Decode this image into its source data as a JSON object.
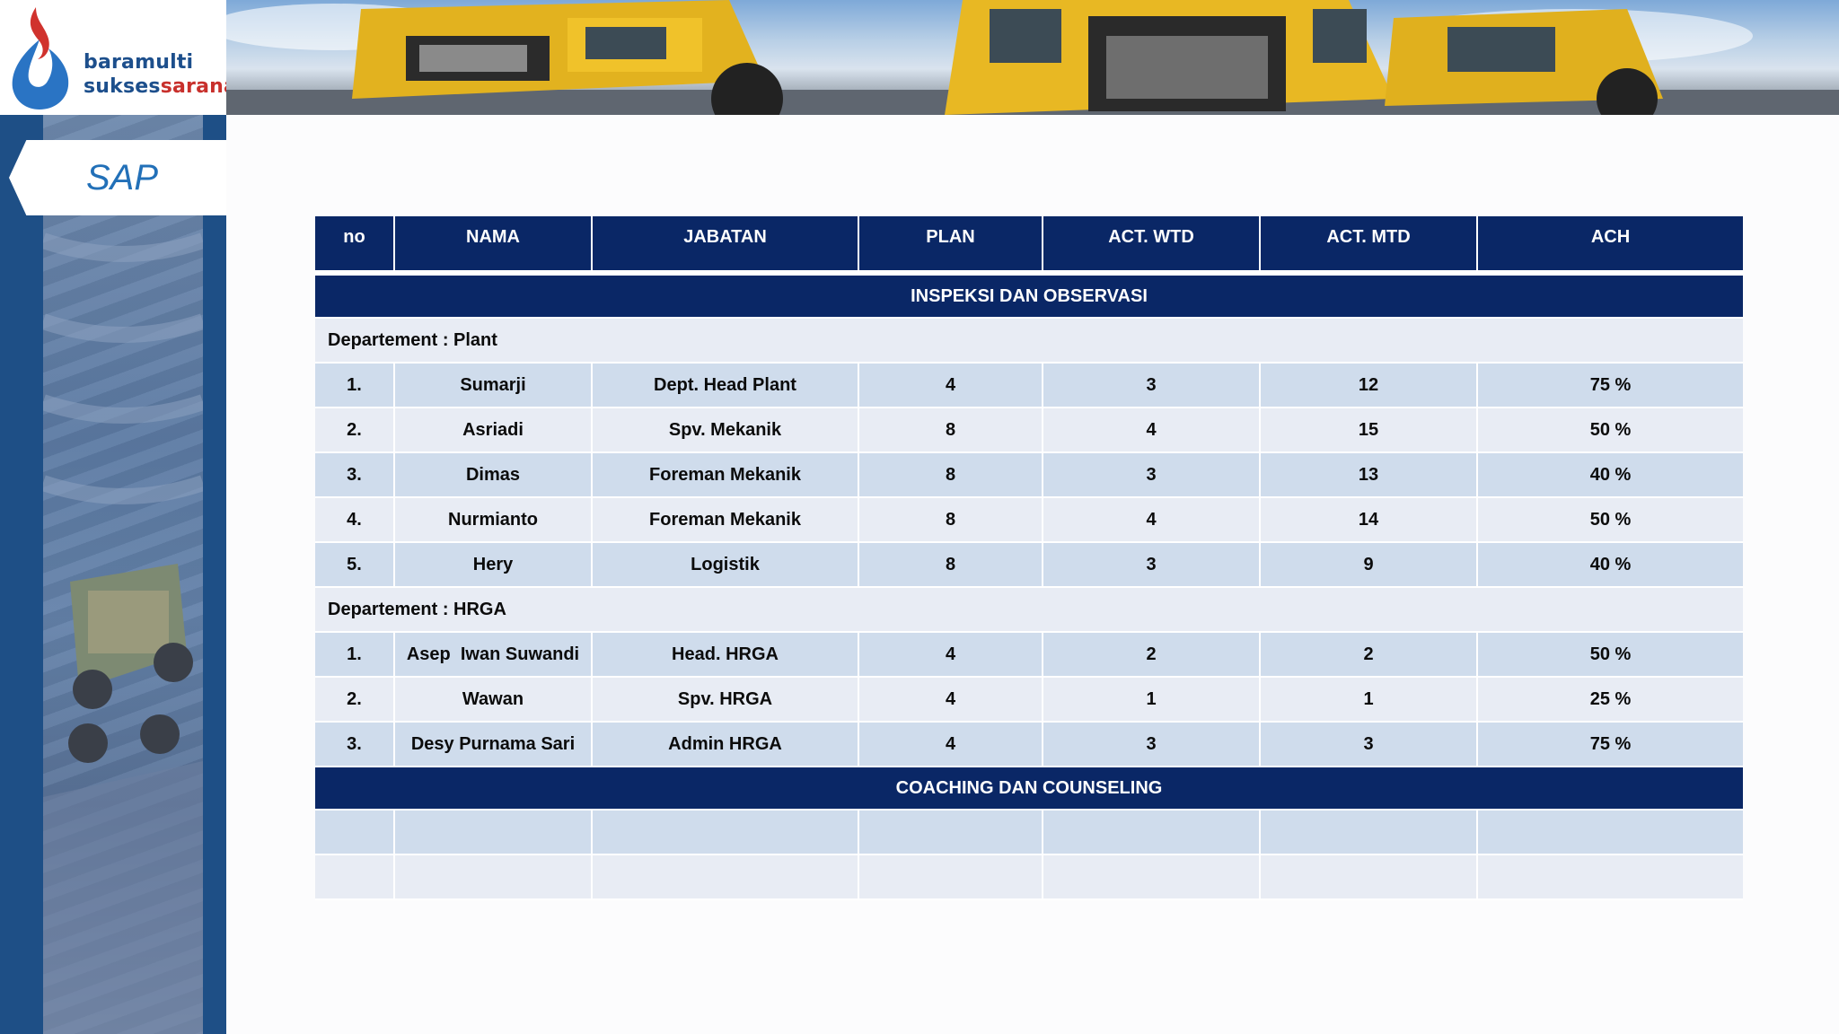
{
  "logo": {
    "line1": "baramulti",
    "line2_main": "sukses",
    "line2_accent": "sarana"
  },
  "sidebar": {
    "tab_label": "SAP"
  },
  "colors": {
    "header_navy": "#0a2766",
    "row_blue": "#cfdcec",
    "row_light": "#e8ecf4",
    "sidebar_blue": "#1e4f86",
    "sap_text": "#2270b8"
  },
  "table": {
    "columns": [
      "no",
      "NAMA",
      "JABATAN",
      "PLAN",
      "ACT. WTD",
      "ACT. MTD",
      "ACH"
    ],
    "section1": "INSPEKSI DAN OBSERVASI",
    "dept_plant": "Departement : Plant",
    "plant_rows": [
      {
        "no": "1.",
        "nama": "Sumarji",
        "jabatan": "Dept. Head Plant",
        "plan": "4",
        "wtd": "3",
        "mtd": "12",
        "ach": "75 %"
      },
      {
        "no": "2.",
        "nama": "Asriadi",
        "jabatan": "Spv. Mekanik",
        "plan": "8",
        "wtd": "4",
        "mtd": "15",
        "ach": "50 %"
      },
      {
        "no": "3.",
        "nama": "Dimas",
        "jabatan": "Foreman Mekanik",
        "plan": "8",
        "wtd": "3",
        "mtd": "13",
        "ach": "40 %"
      },
      {
        "no": "4.",
        "nama": "Nurmianto",
        "jabatan": "Foreman Mekanik",
        "plan": "8",
        "wtd": "4",
        "mtd": "14",
        "ach": "50 %"
      },
      {
        "no": "5.",
        "nama": "Hery",
        "jabatan": "Logistik",
        "plan": "8",
        "wtd": "3",
        "mtd": "9",
        "ach": "40 %"
      }
    ],
    "dept_hrga": "Departement : HRGA",
    "hrga_rows": [
      {
        "no": "1.",
        "nama": "Asep  Iwan Suwandi",
        "jabatan": "Head. HRGA",
        "plan": "4",
        "wtd": "2",
        "mtd": "2",
        "ach": "50 %"
      },
      {
        "no": "2.",
        "nama": "Wawan",
        "jabatan": "Spv. HRGA",
        "plan": "4",
        "wtd": "1",
        "mtd": "1",
        "ach": "25 %"
      },
      {
        "no": "3.",
        "nama": "Desy Purnama Sari",
        "jabatan": "Admin HRGA",
        "plan": "4",
        "wtd": "3",
        "mtd": "3",
        "ach": "75 %"
      }
    ],
    "section2": "COACHING DAN COUNSELING"
  }
}
